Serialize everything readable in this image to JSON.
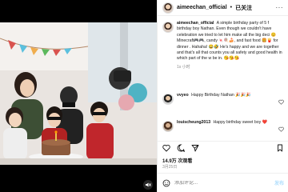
{
  "post": {
    "username": "aimeechan_official",
    "follow_label": "已关注",
    "separator": "•",
    "more_label": "···",
    "caption_username": "aimeechan_official",
    "caption_text": "A simple birthday party of 5 f birthday boy Nathan. Even though we couldn't have celebration we tried to let him make all the big deci 😊 Minecraft🎮🎮, candy 🍬🍭🍰, and fast food 🍔🍟 for dinner . Hahaha! 😂🤣 He's happy and we are together and that's all that counts you all safety and good health in which part of the w be in. 😘😘😘",
    "caption_meta": "1s 小时",
    "comments": [
      {
        "username": "vvyeo",
        "text": "Happy Birthday Nathan 🎉🎉🎉"
      },
      {
        "username": "louischeung2013",
        "text": "Happy birthday sweet boy ❤️"
      }
    ],
    "views": "14.9万 次观看",
    "date": "3月25日",
    "comment_placeholder": "添加评论...",
    "post_label": "发布"
  },
  "icons": {
    "like": "heart-icon",
    "comment": "comment-icon",
    "share": "share-icon",
    "save": "bookmark-icon",
    "emoji": "emoji-icon",
    "mute": "mute-icon"
  },
  "colors": {
    "accent": "#0095f6",
    "muted_text": "#8e8e8e"
  }
}
